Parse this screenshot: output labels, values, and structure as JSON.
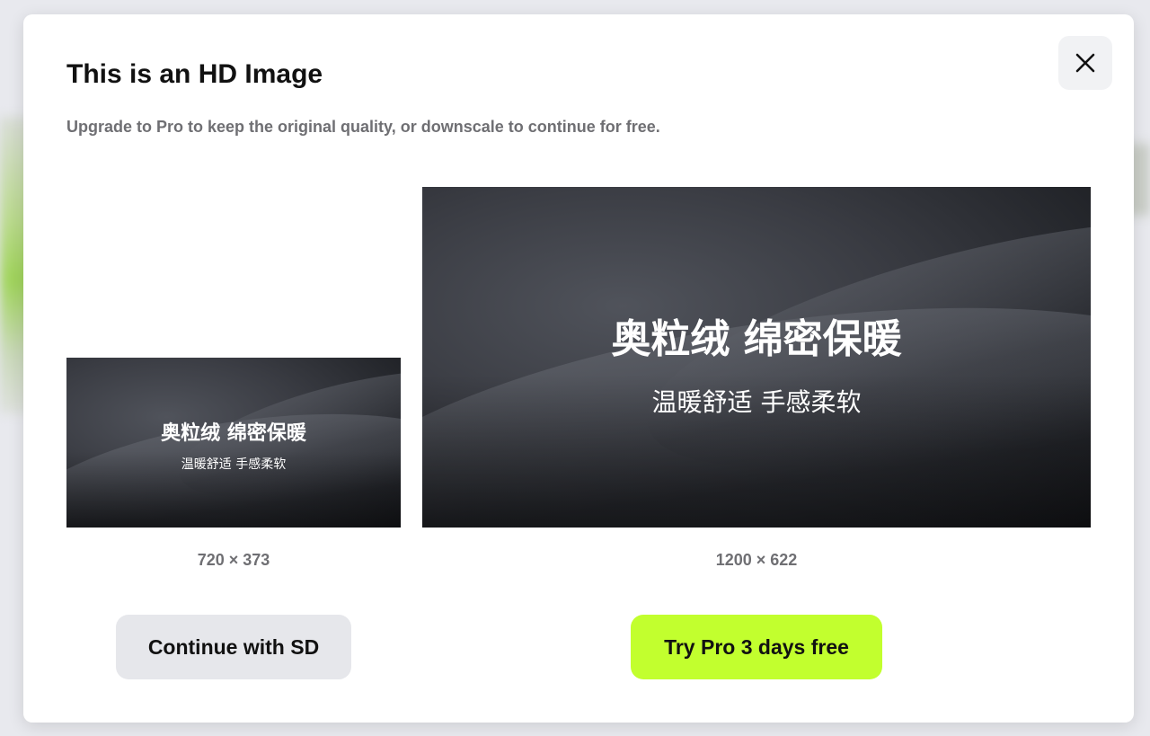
{
  "dialog": {
    "title": "This is an HD Image",
    "subtitle": "Upgrade to Pro to keep the original quality, or downscale to continue for free.",
    "close_icon": "close-icon"
  },
  "sd_option": {
    "image_title": "奥粒绒 绵密保暖",
    "image_subtitle": "温暖舒适 手感柔软",
    "dimensions": "720 × 373",
    "button_label": "Continue with SD"
  },
  "hd_option": {
    "image_title": "奥粒绒 绵密保暖",
    "image_subtitle": "温暖舒适 手感柔软",
    "dimensions": "1200 × 622",
    "button_label": "Try Pro 3 days free"
  },
  "colors": {
    "accent": "#c2ff2e",
    "secondary_button": "#e6e7eb",
    "muted_text": "#6f6f73",
    "fabric": "#3a3c43"
  }
}
